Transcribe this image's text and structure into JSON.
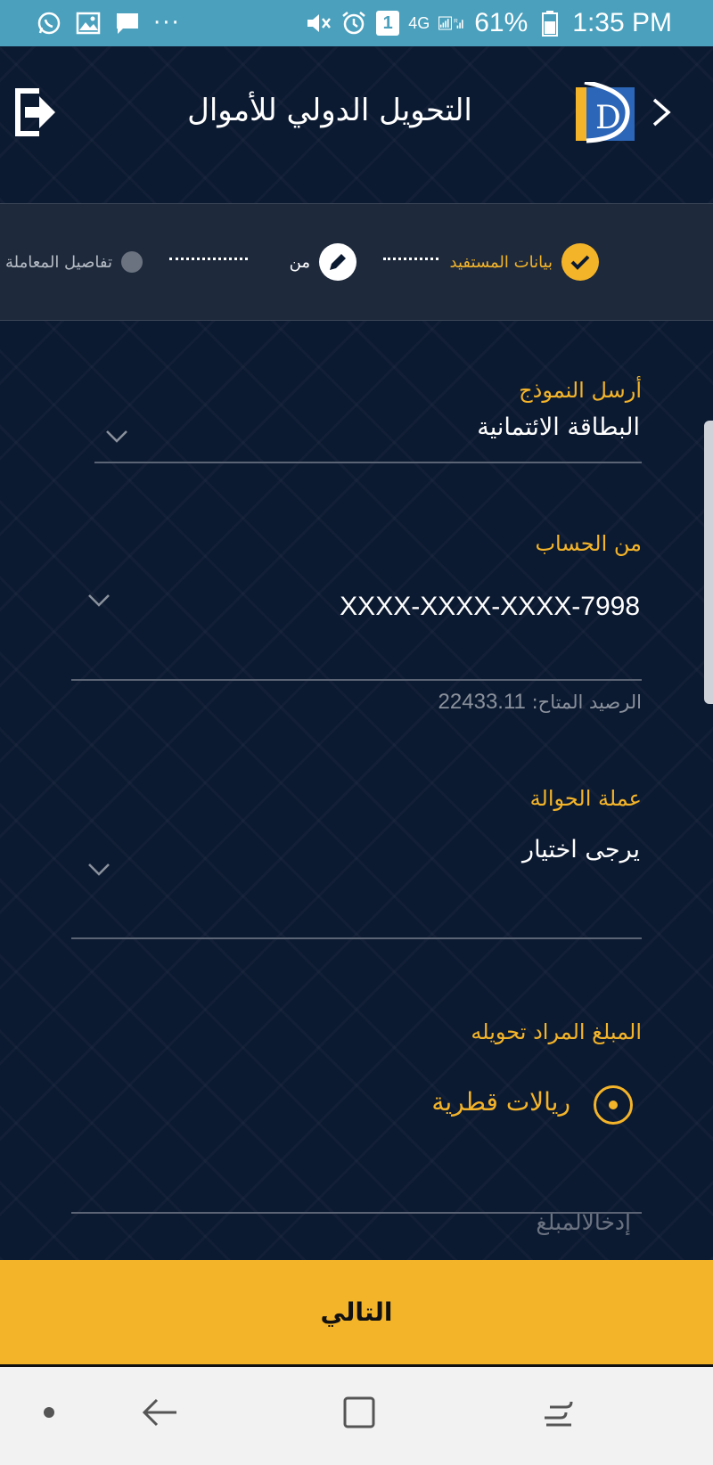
{
  "status_bar": {
    "battery": "61%",
    "time": "1:35 PM",
    "network": "4G",
    "notification_count": "1",
    "more": "···",
    "icons": [
      "whatsapp-icon",
      "gallery-icon",
      "message-icon",
      "mute-icon",
      "alarm-icon",
      "signal-icon",
      "battery-icon"
    ]
  },
  "header": {
    "title": "التحويل الدولي للأموال",
    "logo_letter": "D"
  },
  "stepper": {
    "step1": "بيانات المستفيد",
    "step2": "من",
    "step3": "تفاصيل المعاملة"
  },
  "form": {
    "template": {
      "label": "أرسل النموذج",
      "value": "البطاقة الائتمانية"
    },
    "from_account": {
      "label": "من الحساب",
      "value": "XXXX-XXXX-XXXX-7998",
      "balance_label": "الرصيد المتاح:",
      "balance_value": "22433.11"
    },
    "currency": {
      "label": "عملة الحوالة",
      "value": "يرجى اختيار"
    },
    "amount": {
      "label": "المبلغ المراد تحويله",
      "option": "ريالات قطرية",
      "placeholder": "إدخالالمبلغ"
    }
  },
  "next_button": "التالي",
  "colors": {
    "accent": "#f4b429",
    "background": "#0c1a31",
    "status_bar": "#4aa0bd"
  }
}
